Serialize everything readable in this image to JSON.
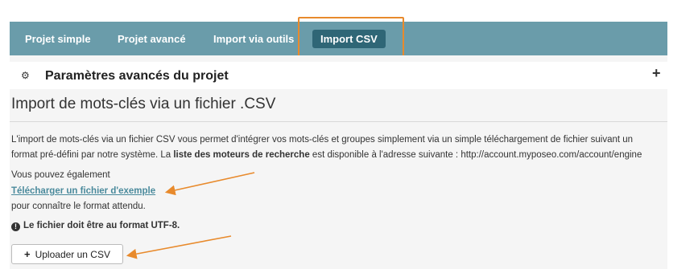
{
  "tabs": [
    {
      "label": "Projet simple",
      "active": false
    },
    {
      "label": "Projet avancé",
      "active": false
    },
    {
      "label": "Import via outils",
      "active": false
    },
    {
      "label": "Import CSV",
      "active": true
    }
  ],
  "panel": {
    "title": "Paramètres avancés du projet",
    "section_title": "Import de mots-clés via un fichier .CSV",
    "description": {
      "part1": "L'import de mots-clés via un fichier CSV vous permet d'intégrer vos mots-clés et groupes simplement via un simple téléchargement de fichier suivant un format pré-défini par notre système. La ",
      "bold": "liste des moteurs de recherche",
      "part2": " est disponible à l'adresse suivante : http://account.myposeo.com/account/engine"
    },
    "also_text": "Vous pouvez également",
    "example_link": "Télécharger un fichier d'exemple",
    "format_text": "pour connaître le format attendu.",
    "warning": "Le fichier doit être au format UTF-8.",
    "upload_button": "Uploader un CSV"
  },
  "colors": {
    "tabbar": "#6a9caa",
    "active_tab": "#2f6676",
    "annotation": "#e88a2c",
    "link": "#4a8a9c"
  },
  "icons": {
    "settings": "gear-icon",
    "expand": "plus-icon",
    "info": "info-icon",
    "upload": "plus-icon"
  }
}
